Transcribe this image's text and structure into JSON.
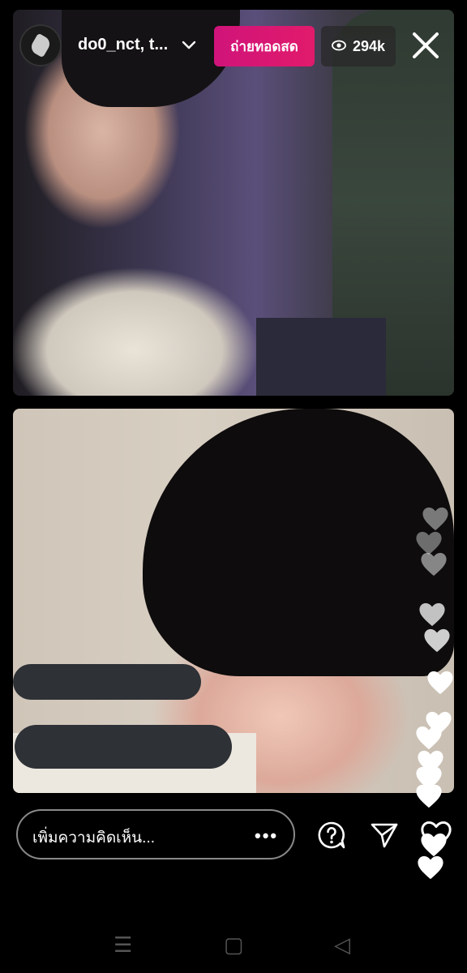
{
  "header": {
    "usernames": "do0_nct, t...",
    "live_label": "ถ่ายทอดสด",
    "viewer_count": "294k"
  },
  "footer": {
    "comment_placeholder": "เพิ่มความคิดเห็น...",
    "more_label": "•••"
  },
  "icons": {
    "close": "close-icon",
    "eye": "eye-icon",
    "chevron": "chevron-down-icon",
    "question": "question-icon",
    "send": "send-icon",
    "heart": "heart-icon"
  },
  "colors": {
    "live_badge": "#d0147a",
    "comment_bubble": "#2e3136"
  },
  "nav": {
    "recent": "☰",
    "home": "▢",
    "back": "◁"
  }
}
